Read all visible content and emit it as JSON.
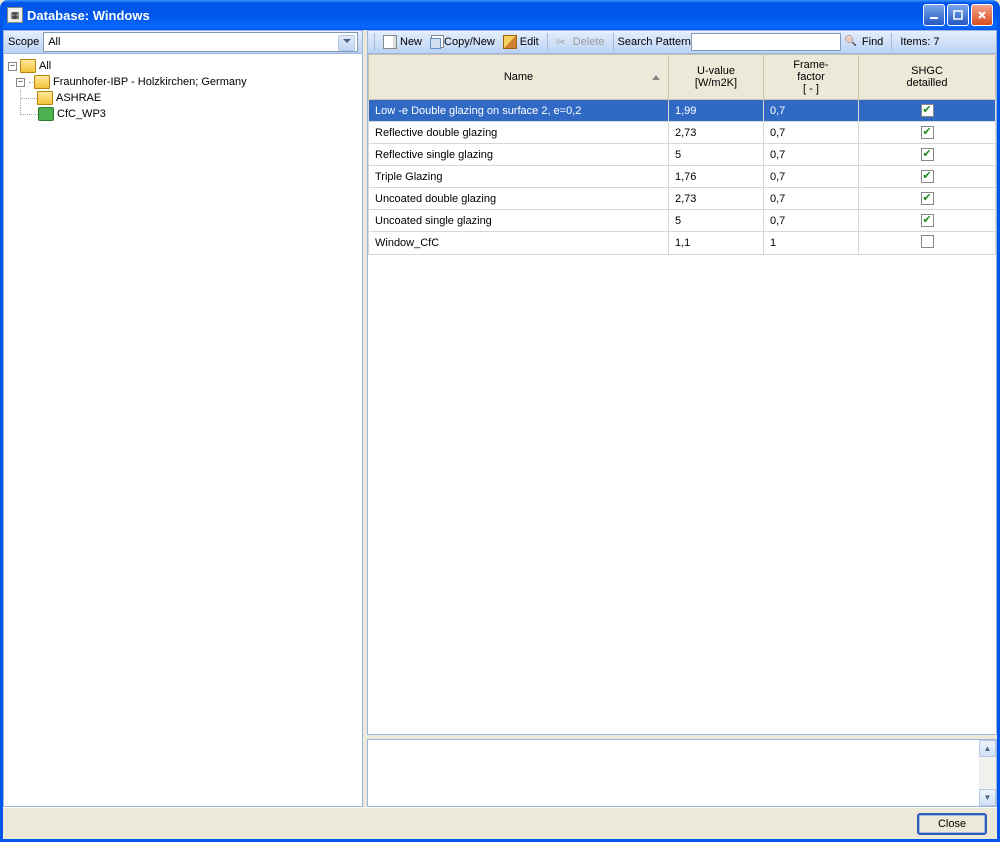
{
  "window": {
    "title": "Database: Windows"
  },
  "sidebar": {
    "scope_label": "Scope",
    "scope_value": "All",
    "tree": {
      "root": "All",
      "items": [
        {
          "label": "Fraunhofer-IBP - Holzkirchen; Germany",
          "children": [
            {
              "label": "ASHRAE"
            }
          ]
        },
        {
          "label": "CfC_WP3"
        }
      ]
    }
  },
  "toolbar": {
    "new_label": "New",
    "copy_label": "Copy/New",
    "edit_label": "Edit",
    "delete_label": "Delete",
    "search_label": "Search Pattern",
    "search_value": "",
    "find_label": "Find",
    "items_label": "Items: 7"
  },
  "table": {
    "columns": {
      "name": "Name",
      "uvalue": "U-value\n[W/m2K]",
      "frame": "Frame-\nfactor\n[ - ]",
      "shgc": "SHGC\ndetailled"
    },
    "rows": [
      {
        "name": "Low -e Double glazing on surface 2, e=0,2",
        "uvalue": "1,99",
        "frame": "0,7",
        "shgc": true,
        "selected": true
      },
      {
        "name": "Reflective double glazing",
        "uvalue": "2,73",
        "frame": "0,7",
        "shgc": true
      },
      {
        "name": "Reflective single glazing",
        "uvalue": "5",
        "frame": "0,7",
        "shgc": true
      },
      {
        "name": "Triple Glazing",
        "uvalue": "1,76",
        "frame": "0,7",
        "shgc": true
      },
      {
        "name": "Uncoated double glazing",
        "uvalue": "2,73",
        "frame": "0,7",
        "shgc": true
      },
      {
        "name": "Uncoated single glazing",
        "uvalue": "5",
        "frame": "0,7",
        "shgc": true
      },
      {
        "name": "Window_CfC",
        "uvalue": "1,1",
        "frame": "1",
        "shgc": false
      }
    ]
  },
  "footer": {
    "close_label": "Close"
  }
}
